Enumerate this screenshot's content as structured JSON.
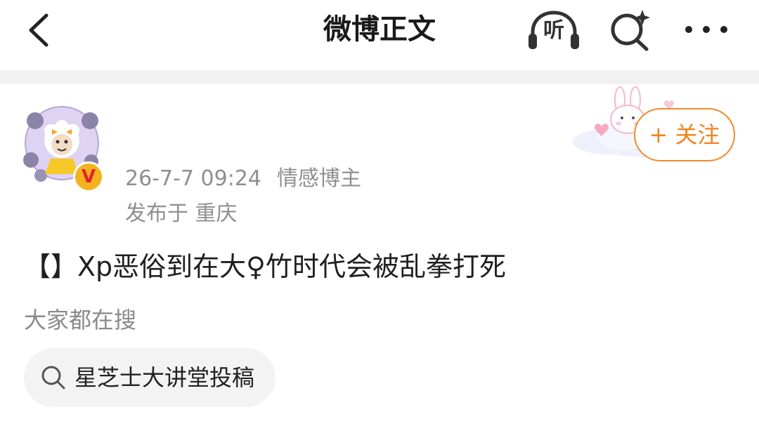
{
  "header": {
    "title": "微博正文",
    "listen_label": "听",
    "icons": [
      "back-arrow-icon",
      "listen-headphones-icon",
      "search-sparkle-icon",
      "more-dots-icon"
    ]
  },
  "post": {
    "author_badge": "V",
    "timestamp": "26-7-7 09:24",
    "author_tag": "情感博主",
    "location": "发布于 重庆",
    "follow_label": "+ 关注",
    "text": "【】Xp恶俗到在大♀竹时代会被乱拳打死"
  },
  "related": {
    "label": "大家都在搜",
    "items": [
      {
        "label": "星芝士大讲堂投稿"
      }
    ]
  },
  "colors": {
    "accent": "#f0831e",
    "muted_text": "#8f8f8f",
    "verified_badge": "#f5b21f",
    "chip_bg": "#f3f3f3"
  }
}
